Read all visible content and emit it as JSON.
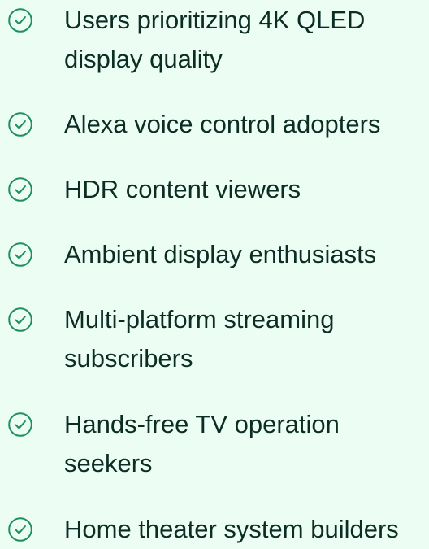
{
  "accent_color": "#1f8f5f",
  "background_color": "#ecfdf4",
  "text_color": "#0b2d24",
  "checklist": {
    "icon": "check-circle-icon",
    "items": [
      {
        "label": "Users prioritizing 4K QLED display quality"
      },
      {
        "label": "Alexa voice control adopters"
      },
      {
        "label": "HDR content viewers"
      },
      {
        "label": "Ambient display enthusiasts"
      },
      {
        "label": "Multi-platform streaming subscribers"
      },
      {
        "label": "Hands-free TV operation seekers"
      },
      {
        "label": "Home theater system builders"
      }
    ]
  }
}
